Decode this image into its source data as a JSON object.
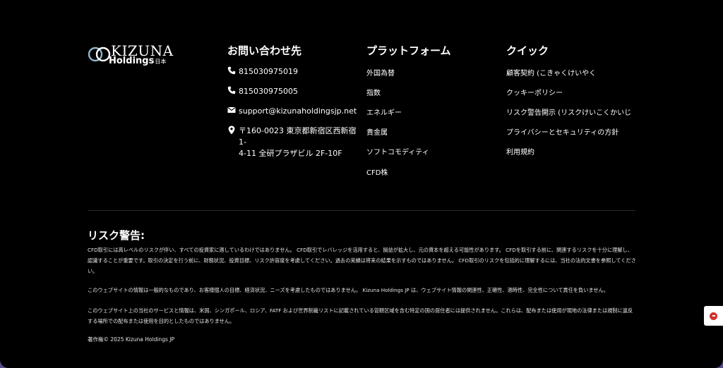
{
  "logo": {
    "top": "KIZUNA",
    "bottom": "Holdings",
    "suffix": "日本"
  },
  "contact": {
    "title": "お問い合わせ先",
    "phone1": "815030975019",
    "phone2": "815030975005",
    "email": "support@kizunaholdingsjp.net",
    "address_line1": "〒160-0023 東京都新宿区西新宿1-",
    "address_line2": "4-11 全研プラザビル 2F-10F",
    "icons": [
      "phone-icon",
      "phone-icon",
      "mail-icon",
      "location-pin-icon"
    ]
  },
  "platform": {
    "title": "プラットフォーム",
    "items": [
      "外国為替",
      "指数",
      "エネルギー",
      "貴金属",
      "ソフトコモディティ",
      "CFD株"
    ]
  },
  "quick": {
    "title": "クイック",
    "items": [
      "顧客契約 (こきゃくけいやく",
      "クッキーポリシー",
      "リスク警告開示 (リスクけいこくかいじ",
      "プライバシーとセキュリティの方針",
      "利用規約"
    ]
  },
  "risk": {
    "title": "リスク警告:",
    "para1": "CFD取引には高レベルのリスクが伴い、すべての投資家に適しているわけではありません。 CFD取引でレバレッジを活用すると、損益が拡大し、元の資本を超える可能性があります。 CFDを取引する前に、関連するリスクを十分に理解し、認識することが重要です。取引の決定を行う前に、財務状況、投資目標、リスク許容度を考慮してください。過去の実績は将来の結果を示すものではありません。 CFD取引のリスクを包括的に理解するには、当社の法的文書を参照してください。",
    "para2": "このウェブサイトの情報は一般的なものであり、お客様個人の目標、経済状況、ニーズを考慮したものではありません。 Kizuna Holdings JP は、ウェブサイト情報の関連性、正確性、適時性、完全性について責任を負いません。",
    "para3": "このウェブサイト上の当社のサービスと情報は、米国、シンガポール、ロシア、FATF および世界制裁リストに記載されている管轄区域を含む特定の国の居住者には提供されません。これらは、配布または使用が現地の法律または規制に違反する場所での配布または使用を目的としたものではありません。",
    "copyright": "著作権© 2025 Kizuna Holdings JP"
  },
  "colors": {
    "background": "#000000",
    "outer": "#5a4a8a",
    "logo_ring": "#8fb3c9",
    "float_accent": "#d32f2f"
  }
}
